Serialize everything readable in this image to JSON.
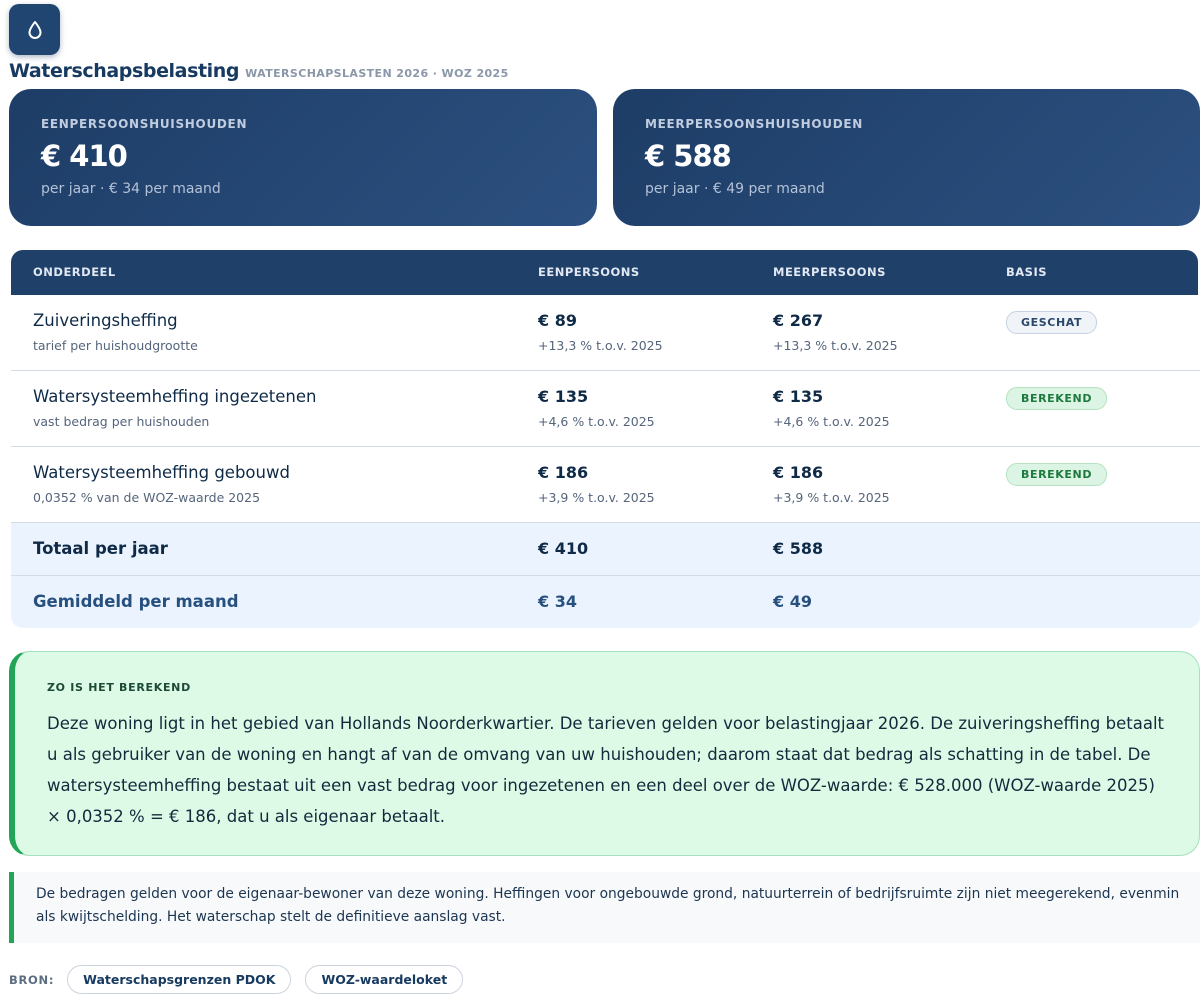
{
  "header": {
    "icon": "droplet-icon",
    "title": "Waterschapsbelasting",
    "subtitle": "WATERSCHAPSLASTEN 2026 · WOZ 2025"
  },
  "summary_cards": [
    {
      "label": "EENPERSOONSHUISHOUDEN",
      "amount": "€ 410",
      "sub": "per jaar · € 34 per maand"
    },
    {
      "label": "MEERPERSOONSHUISHOUDEN",
      "amount": "€ 588",
      "sub": "per jaar · € 49 per maand"
    }
  ],
  "table": {
    "headers": [
      "ONDERDEEL",
      "EENPERSOONS",
      "MEERPERSOONS",
      "BASIS"
    ],
    "rows": [
      {
        "name": "Zuiveringsheffing",
        "desc": "tarief per huishoudgrootte",
        "single": "€ 89",
        "single_change": "+13,3 % t.o.v. 2025",
        "multi": "€ 267",
        "multi_change": "+13,3 % t.o.v. 2025",
        "basis": "GESCHAT"
      },
      {
        "name": "Watersysteemheffing ingezetenen",
        "desc": "vast bedrag per huishouden",
        "single": "€ 135",
        "single_change": "+4,6 % t.o.v. 2025",
        "multi": "€ 135",
        "multi_change": "+4,6 % t.o.v. 2025",
        "basis": "BEREKEND"
      },
      {
        "name": "Watersysteemheffing gebouwd",
        "desc": "0,0352 % van de WOZ-waarde 2025",
        "single": "€ 186",
        "single_change": "+3,9 % t.o.v. 2025",
        "multi": "€ 186",
        "multi_change": "+3,9 % t.o.v. 2025",
        "basis": "BEREKEND"
      }
    ],
    "totals": [
      {
        "label": "Totaal per jaar",
        "single": "€ 410",
        "multi": "€ 588"
      },
      {
        "label": "Gemiddeld per maand",
        "single": "€ 34",
        "multi": "€ 49"
      }
    ]
  },
  "explanation": {
    "label": "ZO IS HET BEREKEND",
    "text": "Deze woning ligt in het gebied van Hollands Noorderkwartier. De tarieven gelden voor belastingjaar 2026. De zuiveringsheffing betaalt u als gebruiker van de woning en hangt af van de omvang van uw huishouden; daarom staat dat bedrag als schatting in de tabel. De watersysteemheffing bestaat uit een vast bedrag voor ingezetenen en een deel over de WOZ-waarde: € 528.000 (WOZ-waarde 2025) × 0,0352 % = € 186, dat u als eigenaar betaalt."
  },
  "note": {
    "text": "De bedragen gelden voor de eigenaar-bewoner van deze woning. Heffingen voor ongebouwde grond, natuurterrein of bedrijfsruimte zijn niet meegerekend, evenmin als kwijtschelding. Het waterschap stelt de definitieve aanslag vast."
  },
  "sources": {
    "label": "BRON:",
    "links": [
      "Waterschapsgrenzen PDOK",
      "WOZ-waardeloket"
    ]
  },
  "colors": {
    "navy": "#1e4069",
    "accent_green": "#21a556",
    "badge_calc_text": "#1d7a3e",
    "total_bg": "#ebf4fe"
  }
}
